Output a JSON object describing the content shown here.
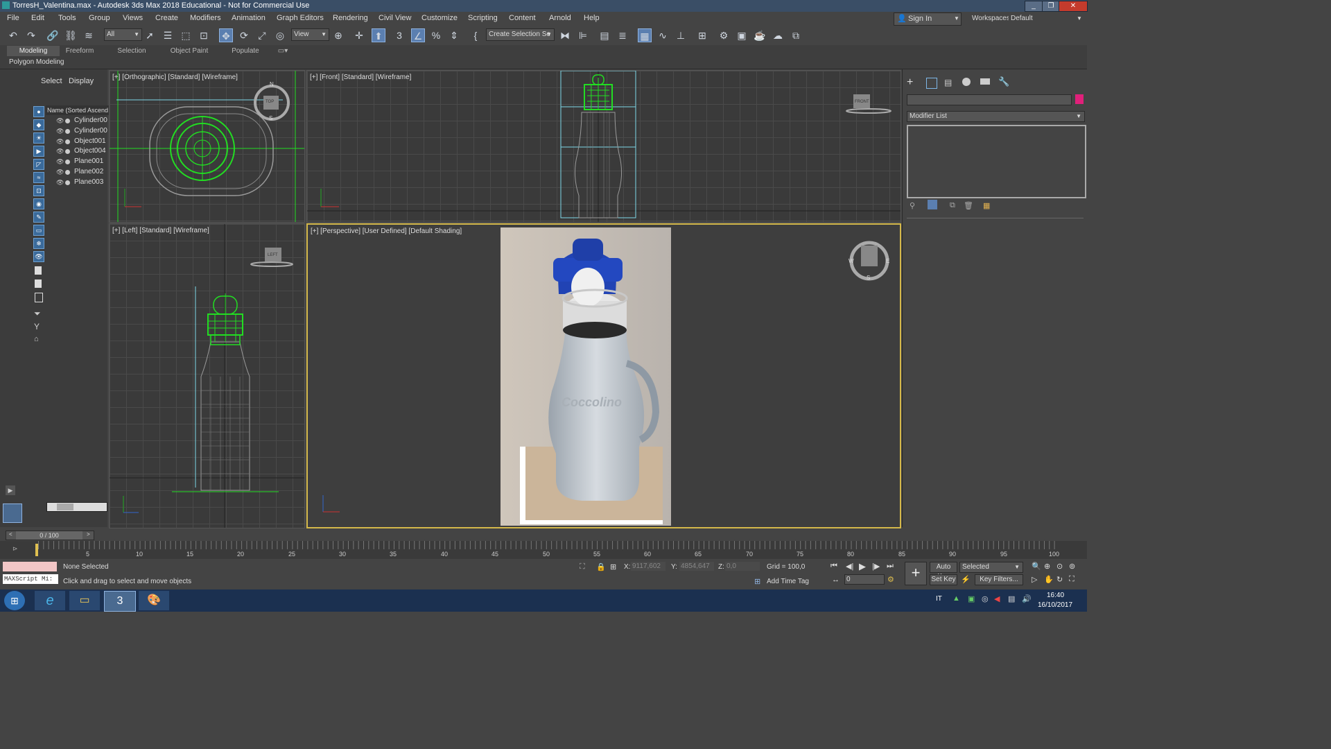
{
  "window": {
    "title": "TorresH_Valentina.max - Autodesk 3ds Max 2018 Educational - Not for Commercial Use"
  },
  "menu": [
    "File",
    "Edit",
    "Tools",
    "Group",
    "Views",
    "Create",
    "Modifiers",
    "Animation",
    "Graph Editors",
    "Rendering",
    "Civil View",
    "Customize",
    "Scripting",
    "Content",
    "Arnold",
    "Help"
  ],
  "account": {
    "sign_in": "Sign In",
    "workspaces_label": "Workspaces:",
    "workspace": "Default"
  },
  "toolbar": {
    "filter": "All",
    "ref_coord": "View",
    "selection_set": "Create Selection Se"
  },
  "ribbon": {
    "tabs": [
      "Modeling",
      "Freeform",
      "Selection",
      "Object Paint",
      "Populate"
    ],
    "active": "Modeling",
    "sub": "Polygon Modeling"
  },
  "explorer": {
    "tabs": [
      "Select",
      "Display"
    ],
    "header": "Name (Sorted Ascend",
    "items": [
      "Cylinder00",
      "Cylinder00",
      "Object001",
      "Object004",
      "Plane001",
      "Plane002",
      "Plane003"
    ]
  },
  "viewports": {
    "top": "[+] [Orthographic] [Standard] [Wireframe]",
    "front": "[+] [Front] [Standard] [Wireframe]",
    "left": "[+] [Left] [Standard] [Wireframe]",
    "persp": "[+] [Perspective] [User Defined] [Default Shading]"
  },
  "viewcube": {
    "top": "TOP",
    "front": "FRONT",
    "left": "LEFT",
    "n": "N",
    "s": "S",
    "e": "E",
    "w": "W"
  },
  "product_label": "Coccolino",
  "command_panel": {
    "modifier_list": "Modifier List"
  },
  "timeline": {
    "frame": "0 / 100",
    "ticks": [
      "5",
      "10",
      "15",
      "20",
      "25",
      "30",
      "35",
      "40",
      "45",
      "50",
      "55",
      "60",
      "65",
      "70",
      "75",
      "80",
      "85",
      "90",
      "95",
      "100"
    ]
  },
  "status": {
    "selection": "None Selected",
    "prompt": "Click and drag to select and move objects",
    "maxscript": "MAXScript Mi:",
    "x_label": "X:",
    "x": "9117,602",
    "y_label": "Y:",
    "y": "4854,647",
    "z_label": "Z:",
    "z": "0,0",
    "grid": "Grid = 100,0",
    "add_time_tag": "Add Time Tag",
    "auto_key": "Auto Key",
    "set_key": "Set Key",
    "key_mode": "Selected",
    "key_filters": "Key Filters...",
    "frame_field": "0"
  },
  "taskbar": {
    "lang": "IT",
    "time": "16:40",
    "date": "16/10/2017"
  },
  "colors": {
    "wire_green": "#22dd22",
    "selection_cyan": "#7fd8e8",
    "accent_blue": "#5b7fb0",
    "title_bar": "#3a4e66",
    "swatch_pink": "#e0207a"
  }
}
